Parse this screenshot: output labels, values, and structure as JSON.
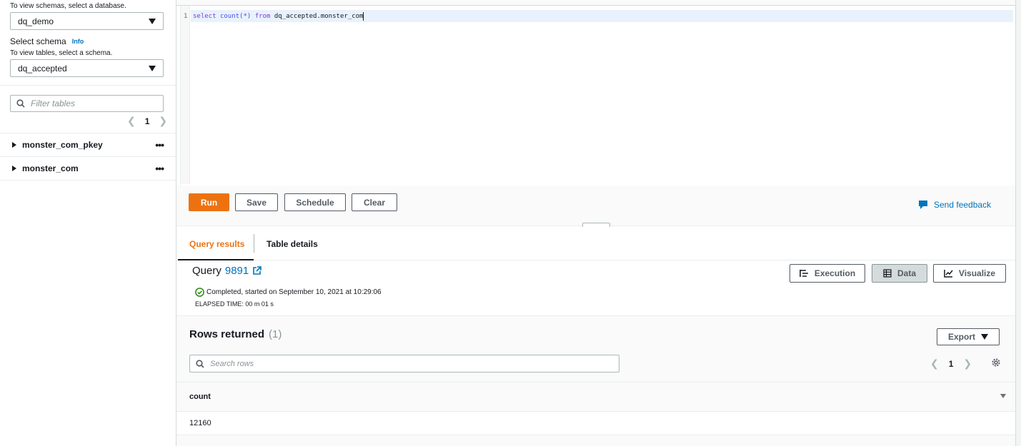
{
  "sidebar": {
    "database_hint": "To view schemas, select a database.",
    "database_value": "dq_demo",
    "schema_label": "Select schema",
    "schema_info": "Info",
    "schema_hint": "To view tables, select a schema.",
    "schema_value": "dq_accepted",
    "filter_placeholder": "Filter tables",
    "page": "1",
    "tables": [
      {
        "name": "monster_com_pkey"
      },
      {
        "name": "monster_com"
      }
    ]
  },
  "editor": {
    "line_number": "1",
    "code": {
      "kw1": "select",
      "fn": "count(*)",
      "kw2": "from",
      "table": "dq_accepted.monster_com"
    }
  },
  "toolbar": {
    "run": "Run",
    "save": "Save",
    "schedule": "Schedule",
    "clear": "Clear",
    "feedback": "Send feedback"
  },
  "results": {
    "tabs": [
      {
        "label": "Query results",
        "active": true
      },
      {
        "label": "Table details",
        "active": false
      }
    ],
    "query_label": "Query",
    "query_id": "9891",
    "status": "Completed, started on September 10, 2021 at 10:29:06",
    "elapsed": "ELAPSED TIME: 00 m 01 s",
    "views": {
      "execution": "Execution",
      "data": "Data",
      "visualize": "Visualize"
    },
    "rows_title": "Rows returned",
    "rows_count": "(1)",
    "export": "Export",
    "search_placeholder": "Search rows",
    "page": "1",
    "columns": [
      "count"
    ],
    "rows": [
      [
        "12160"
      ]
    ]
  },
  "colors": {
    "primary": "#ec7211",
    "link": "#0073bb",
    "success": "#1d8102"
  }
}
